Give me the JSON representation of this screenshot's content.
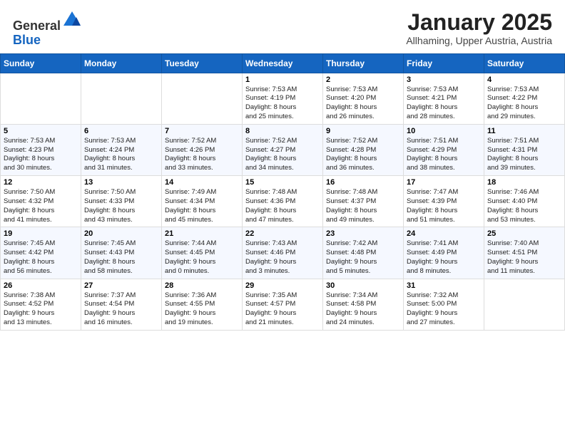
{
  "header": {
    "logo_general": "General",
    "logo_blue": "Blue",
    "month_title": "January 2025",
    "subtitle": "Allhaming, Upper Austria, Austria"
  },
  "weekdays": [
    "Sunday",
    "Monday",
    "Tuesday",
    "Wednesday",
    "Thursday",
    "Friday",
    "Saturday"
  ],
  "weeks": [
    [
      {
        "day": "",
        "info": ""
      },
      {
        "day": "",
        "info": ""
      },
      {
        "day": "",
        "info": ""
      },
      {
        "day": "1",
        "info": "Sunrise: 7:53 AM\nSunset: 4:19 PM\nDaylight: 8 hours\nand 25 minutes."
      },
      {
        "day": "2",
        "info": "Sunrise: 7:53 AM\nSunset: 4:20 PM\nDaylight: 8 hours\nand 26 minutes."
      },
      {
        "day": "3",
        "info": "Sunrise: 7:53 AM\nSunset: 4:21 PM\nDaylight: 8 hours\nand 28 minutes."
      },
      {
        "day": "4",
        "info": "Sunrise: 7:53 AM\nSunset: 4:22 PM\nDaylight: 8 hours\nand 29 minutes."
      }
    ],
    [
      {
        "day": "5",
        "info": "Sunrise: 7:53 AM\nSunset: 4:23 PM\nDaylight: 8 hours\nand 30 minutes."
      },
      {
        "day": "6",
        "info": "Sunrise: 7:53 AM\nSunset: 4:24 PM\nDaylight: 8 hours\nand 31 minutes."
      },
      {
        "day": "7",
        "info": "Sunrise: 7:52 AM\nSunset: 4:26 PM\nDaylight: 8 hours\nand 33 minutes."
      },
      {
        "day": "8",
        "info": "Sunrise: 7:52 AM\nSunset: 4:27 PM\nDaylight: 8 hours\nand 34 minutes."
      },
      {
        "day": "9",
        "info": "Sunrise: 7:52 AM\nSunset: 4:28 PM\nDaylight: 8 hours\nand 36 minutes."
      },
      {
        "day": "10",
        "info": "Sunrise: 7:51 AM\nSunset: 4:29 PM\nDaylight: 8 hours\nand 38 minutes."
      },
      {
        "day": "11",
        "info": "Sunrise: 7:51 AM\nSunset: 4:31 PM\nDaylight: 8 hours\nand 39 minutes."
      }
    ],
    [
      {
        "day": "12",
        "info": "Sunrise: 7:50 AM\nSunset: 4:32 PM\nDaylight: 8 hours\nand 41 minutes."
      },
      {
        "day": "13",
        "info": "Sunrise: 7:50 AM\nSunset: 4:33 PM\nDaylight: 8 hours\nand 43 minutes."
      },
      {
        "day": "14",
        "info": "Sunrise: 7:49 AM\nSunset: 4:34 PM\nDaylight: 8 hours\nand 45 minutes."
      },
      {
        "day": "15",
        "info": "Sunrise: 7:48 AM\nSunset: 4:36 PM\nDaylight: 8 hours\nand 47 minutes."
      },
      {
        "day": "16",
        "info": "Sunrise: 7:48 AM\nSunset: 4:37 PM\nDaylight: 8 hours\nand 49 minutes."
      },
      {
        "day": "17",
        "info": "Sunrise: 7:47 AM\nSunset: 4:39 PM\nDaylight: 8 hours\nand 51 minutes."
      },
      {
        "day": "18",
        "info": "Sunrise: 7:46 AM\nSunset: 4:40 PM\nDaylight: 8 hours\nand 53 minutes."
      }
    ],
    [
      {
        "day": "19",
        "info": "Sunrise: 7:45 AM\nSunset: 4:42 PM\nDaylight: 8 hours\nand 56 minutes."
      },
      {
        "day": "20",
        "info": "Sunrise: 7:45 AM\nSunset: 4:43 PM\nDaylight: 8 hours\nand 58 minutes."
      },
      {
        "day": "21",
        "info": "Sunrise: 7:44 AM\nSunset: 4:45 PM\nDaylight: 9 hours\nand 0 minutes."
      },
      {
        "day": "22",
        "info": "Sunrise: 7:43 AM\nSunset: 4:46 PM\nDaylight: 9 hours\nand 3 minutes."
      },
      {
        "day": "23",
        "info": "Sunrise: 7:42 AM\nSunset: 4:48 PM\nDaylight: 9 hours\nand 5 minutes."
      },
      {
        "day": "24",
        "info": "Sunrise: 7:41 AM\nSunset: 4:49 PM\nDaylight: 9 hours\nand 8 minutes."
      },
      {
        "day": "25",
        "info": "Sunrise: 7:40 AM\nSunset: 4:51 PM\nDaylight: 9 hours\nand 11 minutes."
      }
    ],
    [
      {
        "day": "26",
        "info": "Sunrise: 7:38 AM\nSunset: 4:52 PM\nDaylight: 9 hours\nand 13 minutes."
      },
      {
        "day": "27",
        "info": "Sunrise: 7:37 AM\nSunset: 4:54 PM\nDaylight: 9 hours\nand 16 minutes."
      },
      {
        "day": "28",
        "info": "Sunrise: 7:36 AM\nSunset: 4:55 PM\nDaylight: 9 hours\nand 19 minutes."
      },
      {
        "day": "29",
        "info": "Sunrise: 7:35 AM\nSunset: 4:57 PM\nDaylight: 9 hours\nand 21 minutes."
      },
      {
        "day": "30",
        "info": "Sunrise: 7:34 AM\nSunset: 4:58 PM\nDaylight: 9 hours\nand 24 minutes."
      },
      {
        "day": "31",
        "info": "Sunrise: 7:32 AM\nSunset: 5:00 PM\nDaylight: 9 hours\nand 27 minutes."
      },
      {
        "day": "",
        "info": ""
      }
    ]
  ]
}
